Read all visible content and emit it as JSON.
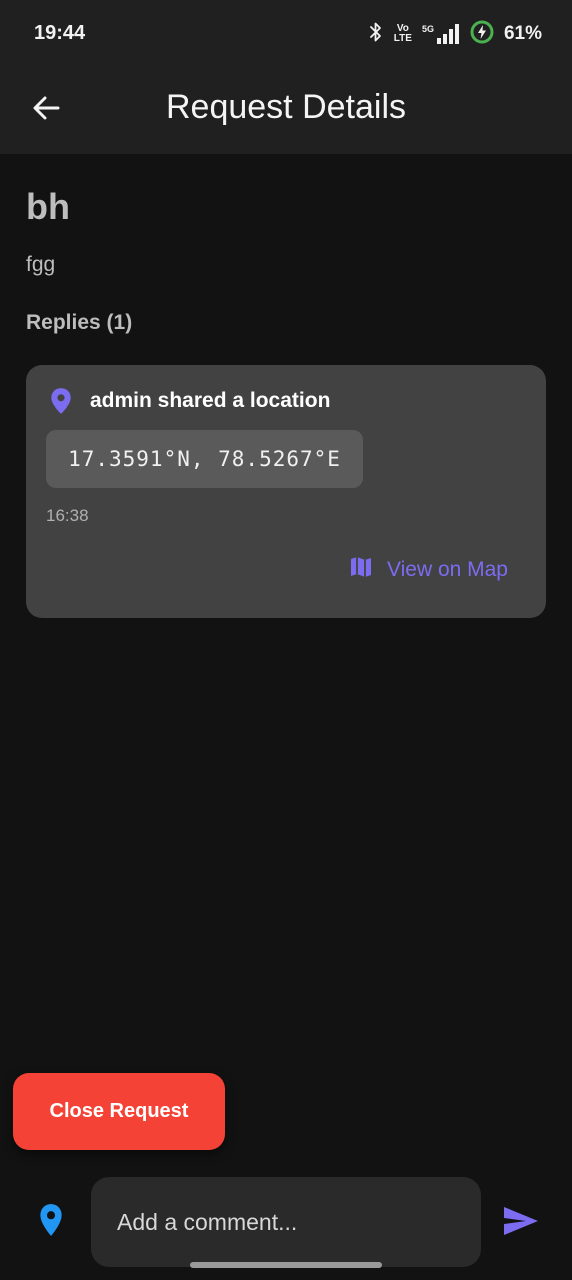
{
  "status_bar": {
    "time": "19:44",
    "volte_top": "Vo",
    "volte_bottom": "LTE",
    "network": "5G",
    "battery": "61%"
  },
  "app_bar": {
    "title": "Request Details",
    "back_icon": "arrow-back-icon"
  },
  "request": {
    "title": "bh",
    "description": "fgg"
  },
  "replies": {
    "heading": "Replies (1)",
    "items": [
      {
        "author_text": "admin shared a location",
        "coordinates": "17.3591°N, 78.5267°E",
        "time": "16:38",
        "action_label": "View on Map",
        "action_icon": "map-icon",
        "pin_icon": "location-pin-icon"
      }
    ]
  },
  "actions": {
    "close_label": "Close Request"
  },
  "composer": {
    "placeholder": "Add a comment...",
    "location_icon": "location-pin-icon",
    "send_icon": "send-icon"
  },
  "colors": {
    "accent": "#7b6cf0",
    "danger": "#f44336",
    "location_blue": "#2196f3",
    "battery_green": "#4caf50"
  }
}
